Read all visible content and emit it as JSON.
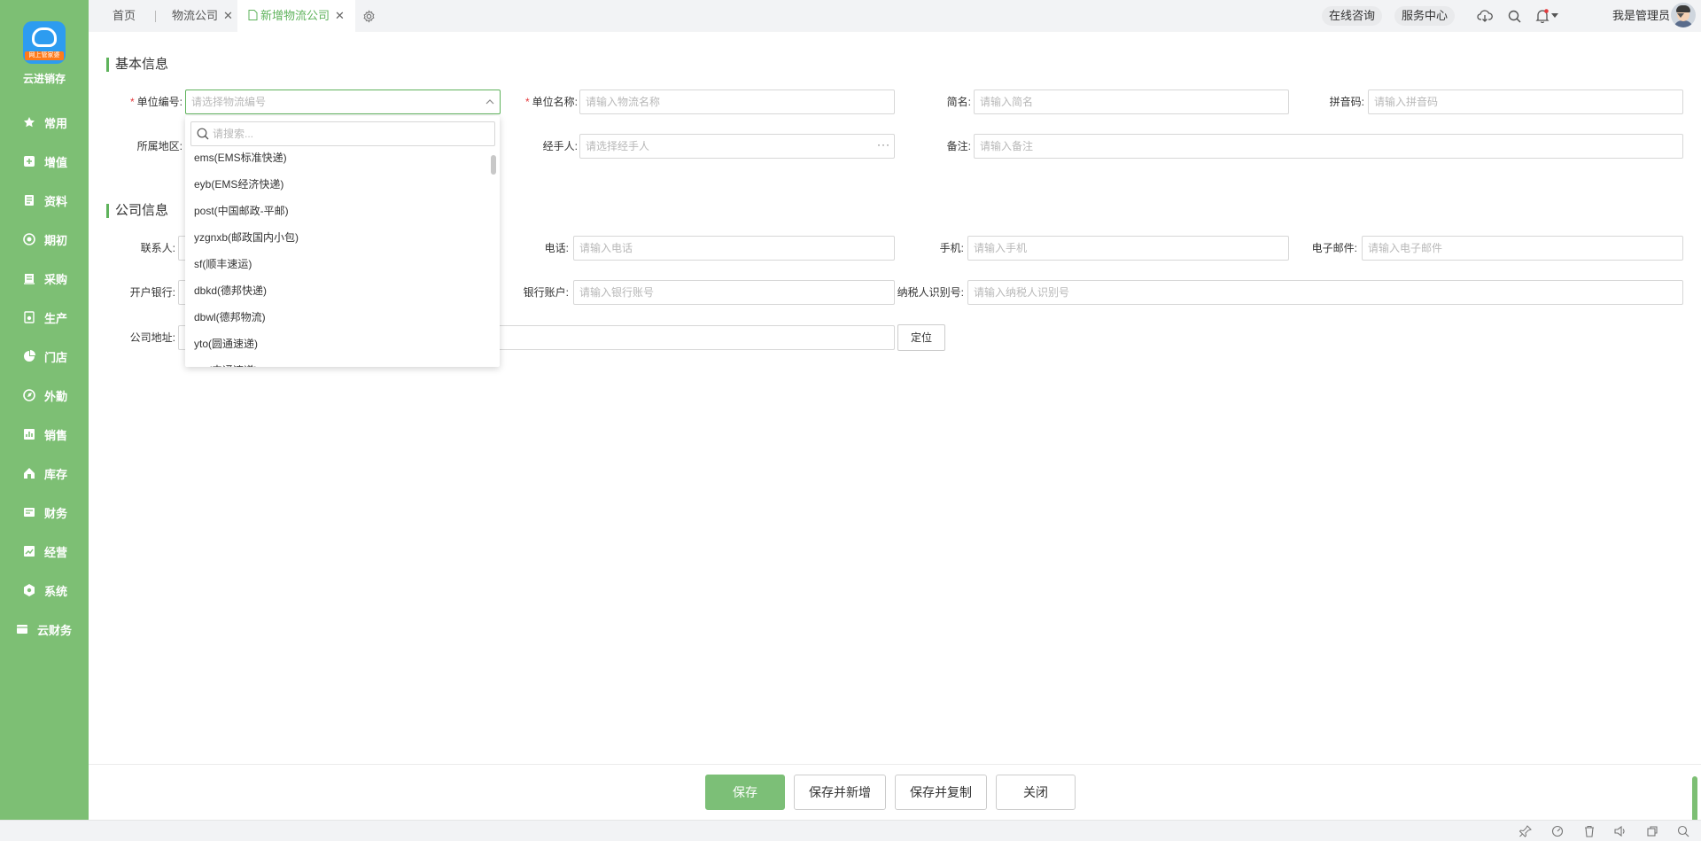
{
  "app": {
    "brand": "云进销存",
    "logo_ribbon": "网上管家婆"
  },
  "colors": {
    "accent": "#5fb35c",
    "sidebar": "#7dbf74",
    "required": "#e4393c"
  },
  "sidebar": {
    "items": [
      {
        "label": "常用",
        "icon": "star-icon"
      },
      {
        "label": "增值",
        "icon": "plus-square-icon"
      },
      {
        "label": "资料",
        "icon": "document-icon"
      },
      {
        "label": "期初",
        "icon": "target-icon"
      },
      {
        "label": "采购",
        "icon": "purchase-icon"
      },
      {
        "label": "生产",
        "icon": "gear-box-icon"
      },
      {
        "label": "门店",
        "icon": "pie-icon"
      },
      {
        "label": "外勤",
        "icon": "compass-icon"
      },
      {
        "label": "销售",
        "icon": "bar-chart-icon"
      },
      {
        "label": "库存",
        "icon": "house-icon"
      },
      {
        "label": "财务",
        "icon": "wallet-icon"
      },
      {
        "label": "经营",
        "icon": "trend-icon"
      },
      {
        "label": "系统",
        "icon": "settings-icon"
      },
      {
        "label": "云财务",
        "icon": "cloud-finance-icon"
      }
    ]
  },
  "topbar": {
    "tabs": [
      {
        "label": "首页"
      },
      {
        "label": "物流公司"
      },
      {
        "label": "新增物流公司"
      }
    ],
    "online_consult": "在线咨询",
    "service_center": "服务中心",
    "user_name": "我是管理员"
  },
  "basic": {
    "title": "基本信息",
    "unit_code": {
      "label": "单位编号:",
      "placeholder": "请选择物流编号"
    },
    "unit_name": {
      "label": "单位名称:",
      "placeholder": "请输入物流名称"
    },
    "short_name": {
      "label": "简名:",
      "placeholder": "请输入简名"
    },
    "pinyin": {
      "label": "拼音码:",
      "placeholder": "请输入拼音码"
    },
    "region": {
      "label": "所属地区:"
    },
    "handler": {
      "label": "经手人:",
      "placeholder": "请选择经手人"
    },
    "remark": {
      "label": "备注:",
      "placeholder": "请输入备注"
    }
  },
  "company": {
    "title": "公司信息",
    "contact": {
      "label": "联系人:"
    },
    "phone": {
      "label": "电话:",
      "placeholder": "请输入电话"
    },
    "mobile": {
      "label": "手机:",
      "placeholder": "请输入手机"
    },
    "email": {
      "label": "电子邮件:",
      "placeholder": "请输入电子邮件"
    },
    "bank": {
      "label": "开户银行:"
    },
    "account": {
      "label": "银行账户:",
      "placeholder": "请输入银行账号"
    },
    "taxid": {
      "label": "纳税人识别号:",
      "placeholder": "请输入纳税人识别号"
    },
    "address": {
      "label": "公司地址:"
    },
    "locate_label": "定位"
  },
  "dropdown": {
    "search_placeholder": "请搜索...",
    "options": [
      "ems(EMS标准快递)",
      "eyb(EMS经济快递)",
      "post(中国邮政-平邮)",
      "yzgnxb(邮政国内小包)",
      "sf(顺丰速运)",
      "dbkd(德邦快递)",
      "dbwl(德邦物流)",
      "yto(圆通速递)",
      "sto(申通速递)"
    ]
  },
  "footer": {
    "save": "保存",
    "save_new": "保存并新增",
    "save_copy": "保存并复制",
    "close": "关闭"
  }
}
